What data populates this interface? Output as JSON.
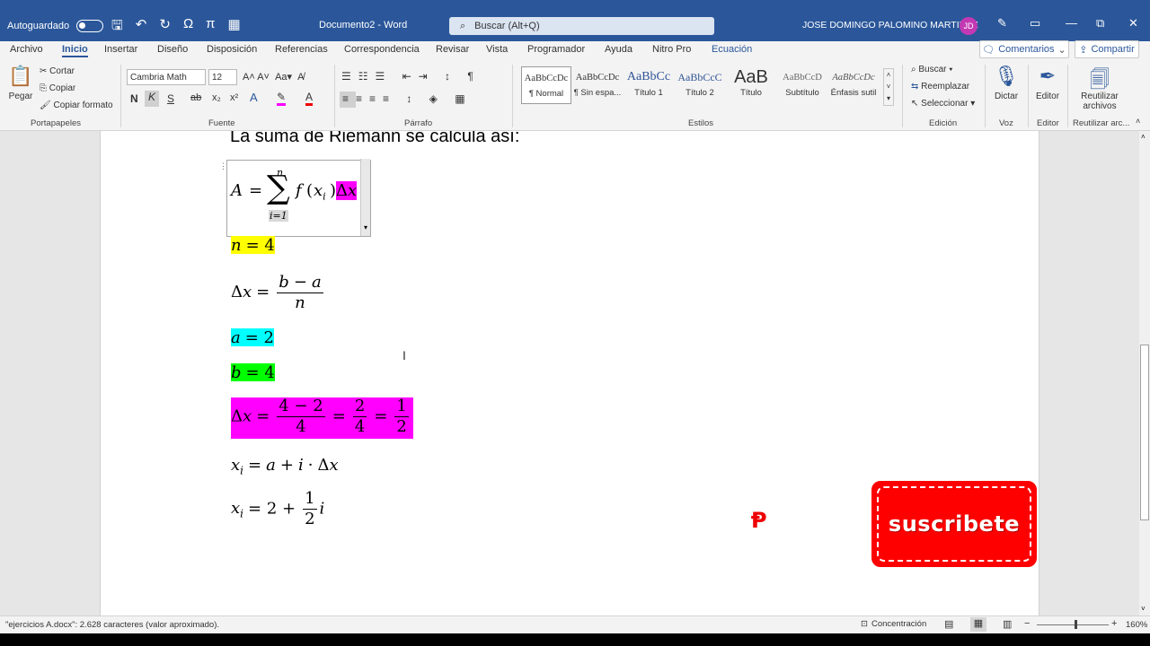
{
  "titlebar": {
    "autosave_label": "Autoguardado",
    "doc_title": "Documento2 - Word",
    "search_placeholder": "Buscar (Alt+Q)",
    "user_name": "JOSE DOMINGO PALOMINO MARTINEZ",
    "user_initials": "JD"
  },
  "tabs": [
    "Archivo",
    "Inicio",
    "Insertar",
    "Diseño",
    "Disposición",
    "Referencias",
    "Correspondencia",
    "Revisar",
    "Vista",
    "Programador",
    "Ayuda",
    "Nitro Pro",
    "Ecuación"
  ],
  "header_buttons": {
    "comments": "Comentarios",
    "share": "Compartir"
  },
  "ribbon": {
    "clipboard": {
      "paste": "Pegar",
      "cut": "Cortar",
      "copy": "Copiar",
      "format_painter": "Copiar formato",
      "label": "Portapapeles"
    },
    "font": {
      "name": "Cambria Math",
      "size": "12",
      "label": "Fuente"
    },
    "paragraph": {
      "label": "Párrafo"
    },
    "styles": {
      "label": "Estilos",
      "items": [
        {
          "preview": "AaBbCcDc",
          "name": "¶ Normal"
        },
        {
          "preview": "AaBbCcDc",
          "name": "¶ Sin espa..."
        },
        {
          "preview": "AaBbCc",
          "name": "Título 1"
        },
        {
          "preview": "AaBbCcC",
          "name": "Título 2"
        },
        {
          "preview": "AaB",
          "name": "Título"
        },
        {
          "preview": "AaBbCcD",
          "name": "Subtítulo"
        },
        {
          "preview": "AaBbCcDc",
          "name": "Énfasis sutil"
        }
      ]
    },
    "editing": {
      "find": "Buscar",
      "replace": "Reemplazar",
      "select": "Seleccionar",
      "label": "Edición"
    },
    "voice": {
      "dictate": "Dictar",
      "label": "Voz"
    },
    "editor": {
      "editor": "Editor",
      "label": "Editor"
    },
    "reuse": {
      "line1": "Reutilizar",
      "line2": "archivos",
      "label": "Reutilizar arc..."
    }
  },
  "document": {
    "heading": "La suma de Riemann se calcula así:",
    "sum_upper": "n",
    "sum_lower": "i=1",
    "n_eq": "n = 4",
    "a_eq": "a = 2",
    "b_eq": "b = 4"
  },
  "subscribe_label": "suscribete",
  "status": {
    "chars": "\"ejercicios A.docx\": 2.628 caracteres (valor aproximado).",
    "focus": "Concentración",
    "zoom": "160%"
  }
}
